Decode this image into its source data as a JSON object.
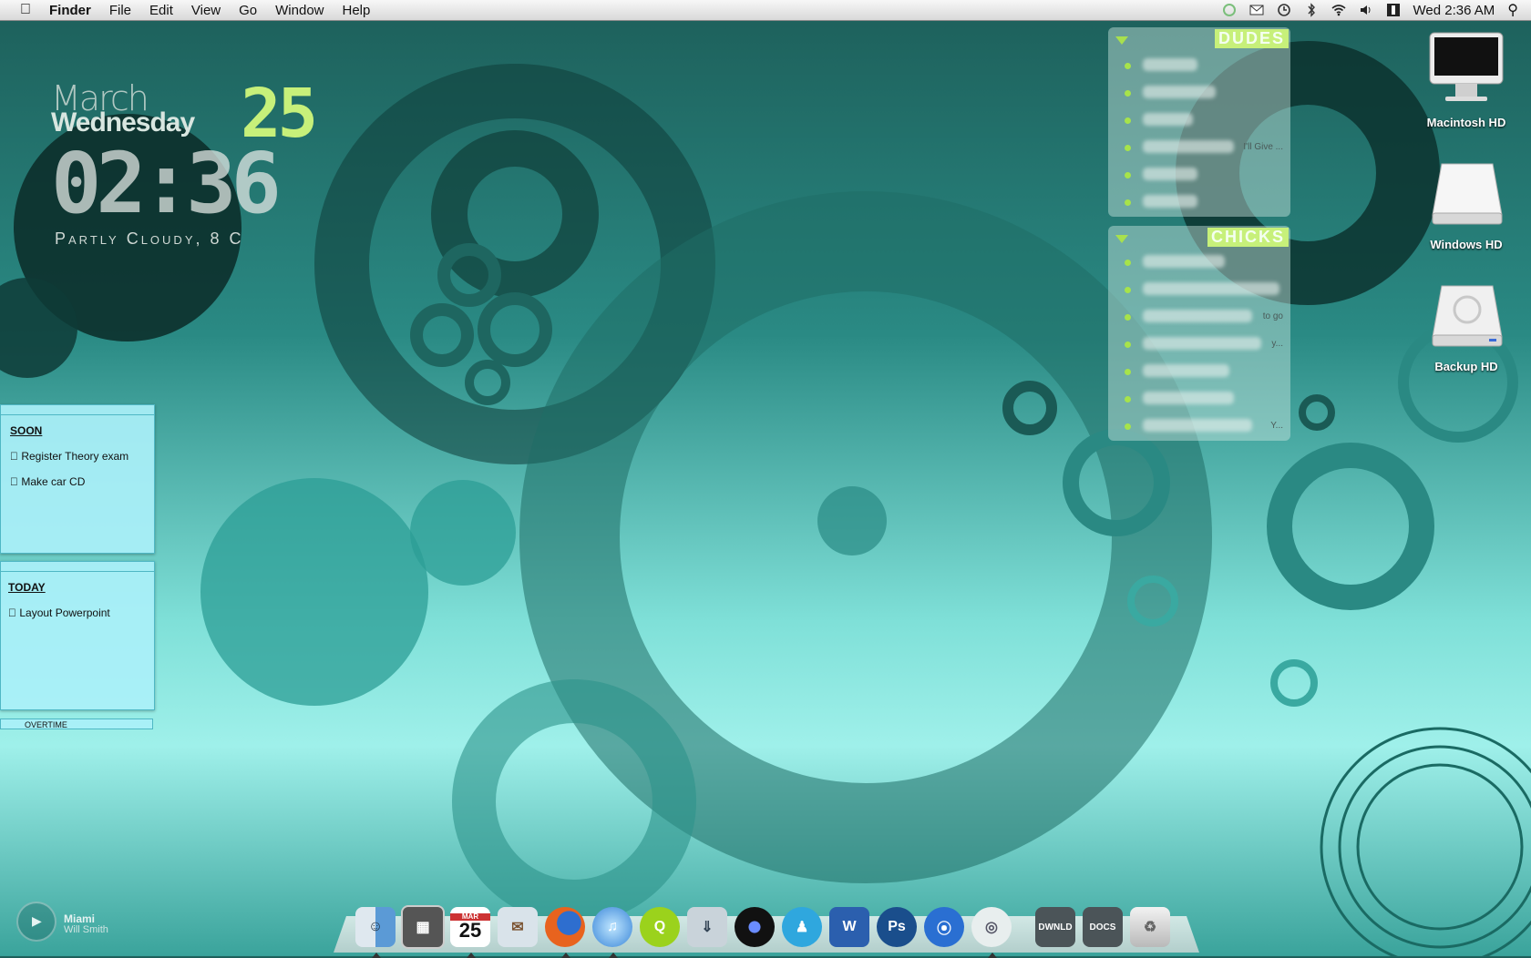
{
  "menubar": {
    "app_name": "Finder",
    "menus": [
      "File",
      "Edit",
      "View",
      "Go",
      "Window",
      "Help"
    ],
    "clock": "Wed  2:36 AM",
    "status_icons": [
      "sync-icon",
      "mail-icon",
      "time-machine-icon",
      "bluetooth-icon",
      "wifi-icon",
      "volume-icon",
      "input-icon"
    ]
  },
  "clock_widget": {
    "month": "March",
    "weekday": "Wednesday",
    "date": "25",
    "time": "02:36",
    "weather": "Partly Cloudy, 8 C"
  },
  "notes": {
    "soon": {
      "title": "SOON",
      "items": [
        "Register Theory exam",
        "Make car CD"
      ]
    },
    "today": {
      "title": "TODAY",
      "items": [
        "Layout Powerpoint"
      ]
    },
    "overtime": "OVERTIME"
  },
  "buddy_lists": {
    "dudes": {
      "title": "DUDES",
      "statuses": [
        "",
        "",
        "",
        "I'll Give ...",
        "",
        ""
      ]
    },
    "chicks": {
      "title": "CHICKS",
      "statuses": [
        "",
        "",
        "to go",
        "y...",
        "",
        "",
        "Y..."
      ]
    }
  },
  "desktop_icons": [
    {
      "label": "Macintosh HD"
    },
    {
      "label": "Windows HD"
    },
    {
      "label": "Backup HD"
    }
  ],
  "now_playing": {
    "title": "Miami",
    "artist": "Will Smith"
  },
  "dock": {
    "calendar_month": "MAR",
    "calendar_day": "25",
    "stack_downloads": "DWNLD",
    "stack_docs": "DOCS",
    "accent_colors": {
      "firefox": "#e8631e",
      "quicktime": "#9bd21c",
      "photoshop": "#1a4e8c",
      "messenger": "#2fa7de"
    }
  }
}
